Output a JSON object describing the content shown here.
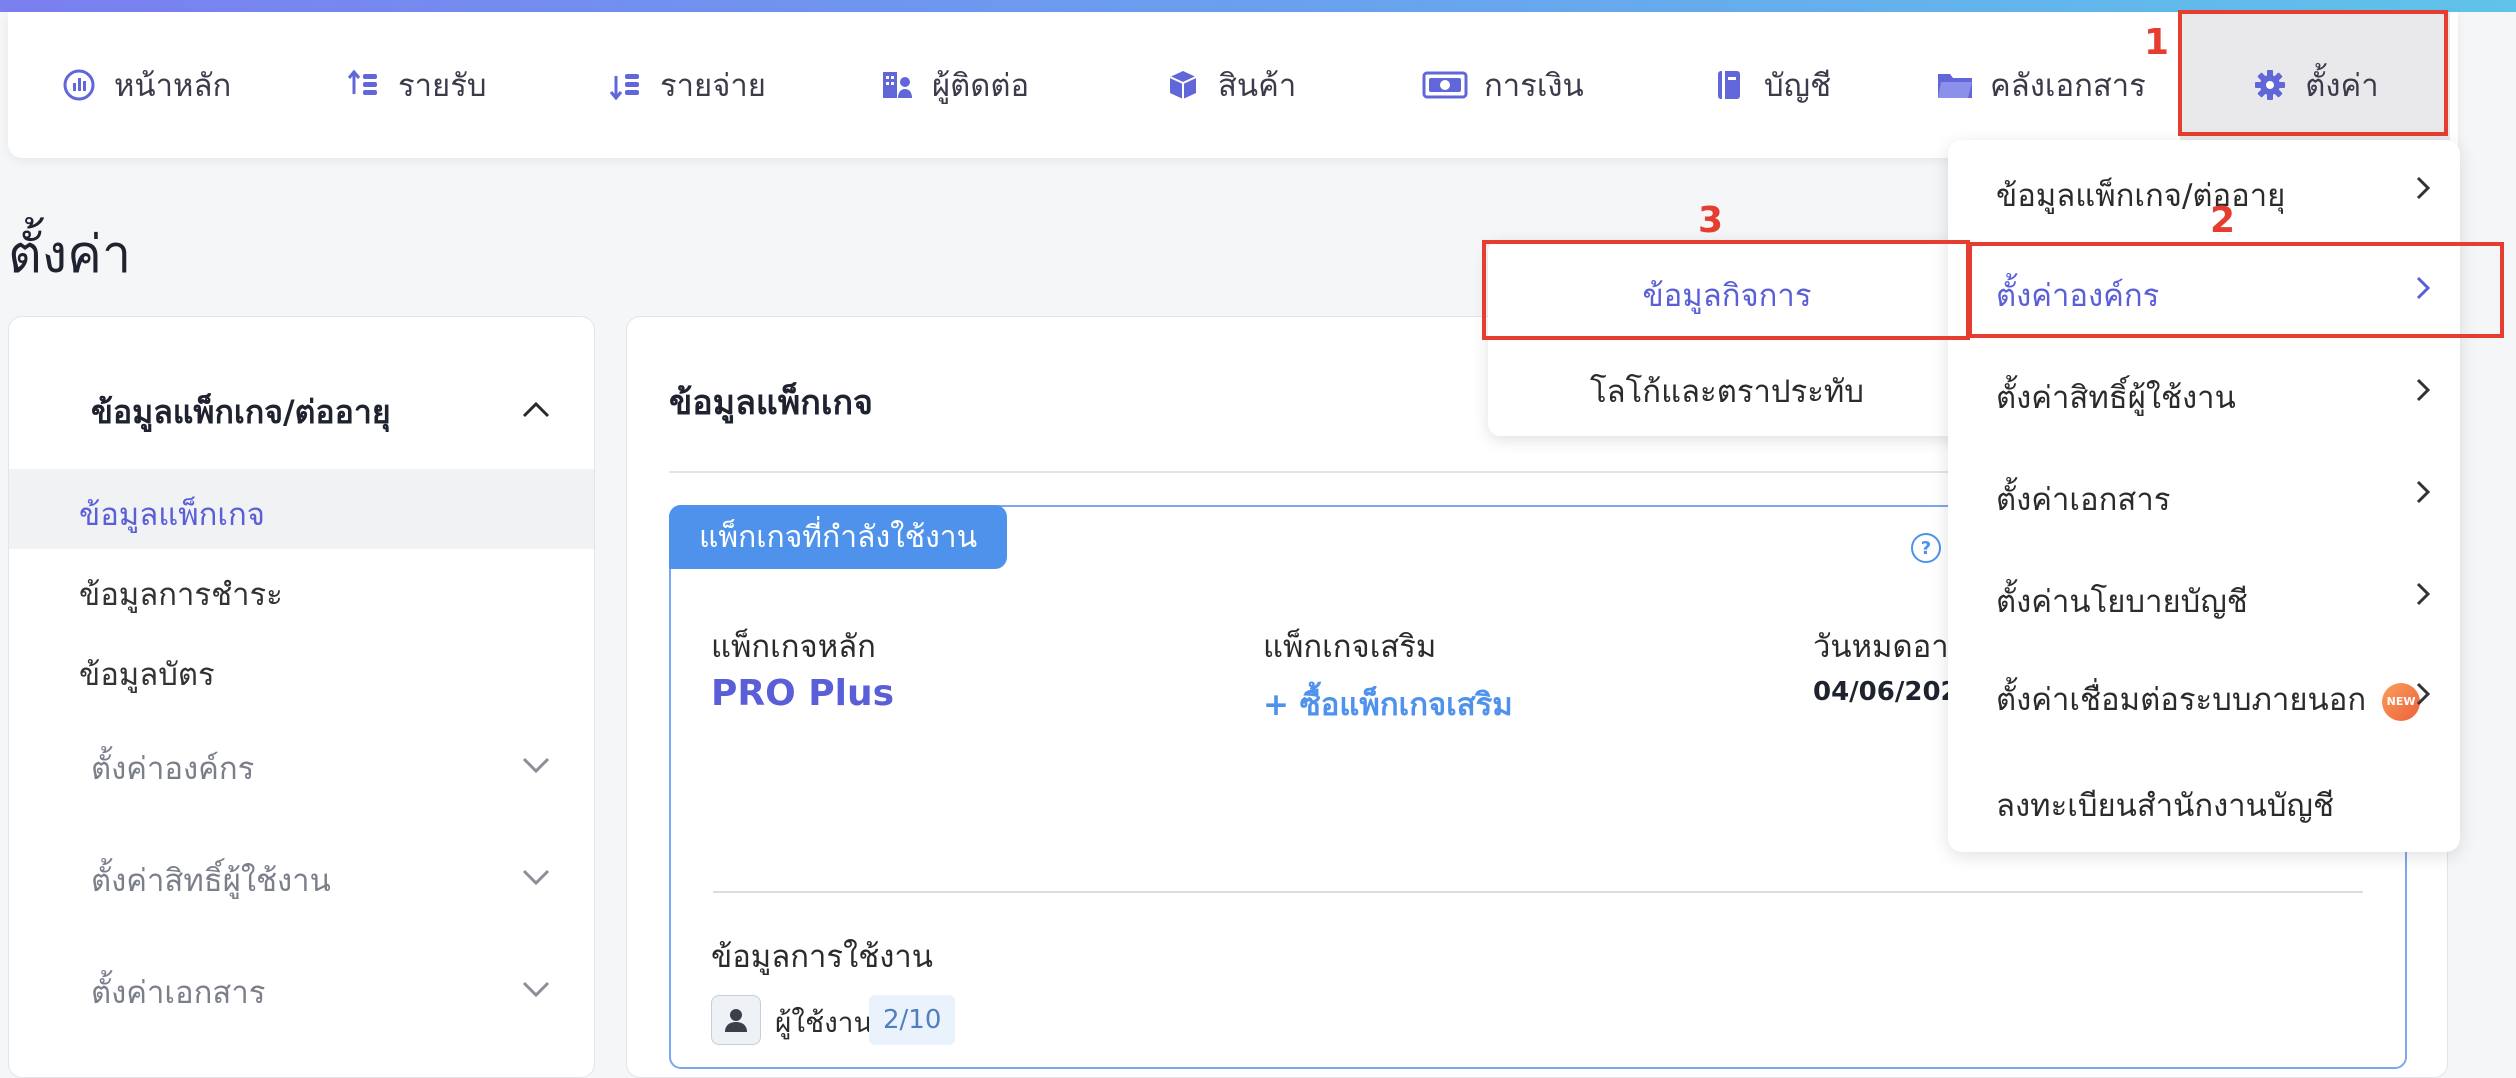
{
  "nav": {
    "items": [
      {
        "label": "หน้าหลัก",
        "icon": "dashboard-icon"
      },
      {
        "label": "รายรับ",
        "icon": "income-icon"
      },
      {
        "label": "รายจ่าย",
        "icon": "expense-icon"
      },
      {
        "label": "ผู้ติดต่อ",
        "icon": "contacts-icon"
      },
      {
        "label": "สินค้า",
        "icon": "product-box-icon"
      },
      {
        "label": "การเงิน",
        "icon": "money-icon"
      },
      {
        "label": "บัญชี",
        "icon": "ledger-book-icon"
      },
      {
        "label": "คลังเอกสาร",
        "icon": "folder-icon"
      },
      {
        "label": "ตั้งค่า",
        "icon": "gear-icon"
      }
    ],
    "active_index": 8
  },
  "annotations": {
    "step1": "1",
    "step2": "2",
    "step3": "3"
  },
  "page": {
    "title": "ตั้งค่า"
  },
  "sidebar": {
    "section_title": "ข้อมูลแพ็กเกจ/ต่ออายุ",
    "sub_items": [
      "ข้อมูลแพ็กเกจ",
      "ข้อมูลการชำระ",
      "ข้อมูลบัตร"
    ],
    "groups": [
      "ตั้งค่าองค์กร",
      "ตั้งค่าสิทธิ์ผู้ใช้งาน",
      "ตั้งค่าเอกสาร"
    ]
  },
  "main": {
    "title": "ข้อมูลแพ็กเกจ",
    "current_tag": "แพ็กเกจที่กำลังใช้งาน",
    "main_package_label": "แพ็กเกจหลัก",
    "main_package_value": "PRO Plus",
    "addon_label": "แพ็กเกจเสริม",
    "addon_link": "+ ซื้อแพ็กเกจเสริม",
    "expiry_label": "วันหมดอาย",
    "expiry_value": "04/06/202",
    "usage_title": "ข้อมูลการใช้งาน",
    "users_label": "ผู้ใช้งาน",
    "users_count": "2/10"
  },
  "dropdown": {
    "items": [
      "ข้อมูลแพ็กเกจ/ต่ออายุ",
      "ตั้งค่าองค์กร",
      "ตั้งค่าสิทธิ์ผู้ใช้งาน",
      "ตั้งค่าเอกสาร",
      "ตั้งค่านโยบายบัญชี",
      "ตั้งค่าเชื่อมต่อระบบภายนอก",
      "ลงทะเบียนสำนักงานบัญชี"
    ],
    "new_badge": "NEW"
  },
  "submenu": {
    "items": [
      "ข้อมูลกิจการ",
      "โลโก้และตราประทับ"
    ]
  },
  "colors": {
    "accent": "#5a5fd8",
    "highlight": "#e53d2f",
    "blue": "#4f92ec"
  }
}
